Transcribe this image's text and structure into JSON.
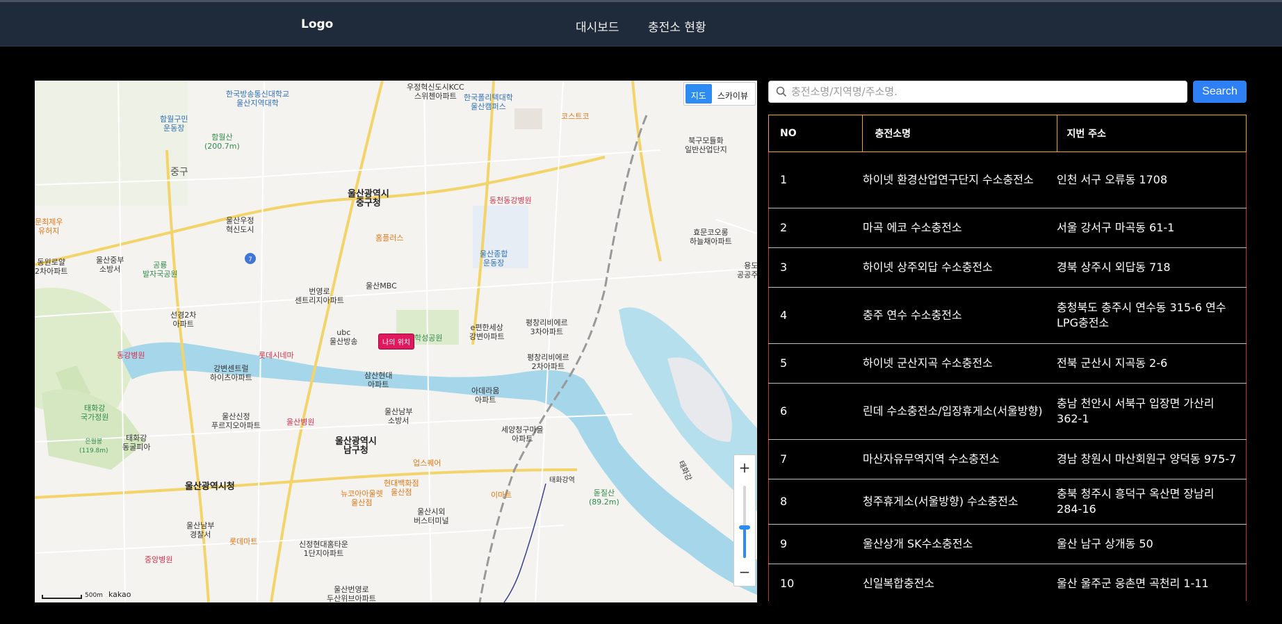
{
  "navbar": {
    "logo": "Logo",
    "links": [
      "대시보드",
      "충전소 현황"
    ]
  },
  "map": {
    "maptype": {
      "map": "지도",
      "skyview": "스카이뷰"
    },
    "my_location": "나의 위치",
    "scale": "500m",
    "provider": "kakao",
    "zoom_in": "+",
    "zoom_out": "−",
    "zoom_level_fraction": 0.42,
    "labels": [
      {
        "text": "우정혁신도시KCC\n스위첸아파트",
        "cls": ""
      },
      {
        "text": "한국방송통신대학교\n울산지역대학",
        "cls": "blue"
      },
      {
        "text": "한국폴리텍대학\n울산캠퍼스",
        "cls": "blue"
      },
      {
        "text": "코스트코",
        "cls": "orange"
      },
      {
        "text": "함월구민\n운동장",
        "cls": "blue"
      },
      {
        "text": "함월산\n(200.7m)",
        "cls": "green"
      },
      {
        "text": "중구",
        "cls": "district"
      },
      {
        "text": "북구모듈화\n일반산업단지",
        "cls": ""
      },
      {
        "text": "울산광역시\n중구청",
        "cls": "big"
      },
      {
        "text": "동천동강병원",
        "cls": "red"
      },
      {
        "text": "문최제우\n유허지",
        "cls": "orange"
      },
      {
        "text": "울산우정\n혁신도시",
        "cls": ""
      },
      {
        "text": "홈플러스",
        "cls": "orange"
      },
      {
        "text": "효문코오롱\n하늘채아파트",
        "cls": ""
      },
      {
        "text": "동원로얄\n2차아파트",
        "cls": ""
      },
      {
        "text": "울산중부\n소방서",
        "cls": ""
      },
      {
        "text": "공룡\n발자국공원",
        "cls": "green"
      },
      {
        "text": "울산종합\n운동장",
        "cls": "blue"
      },
      {
        "text": "울산MBC",
        "cls": ""
      },
      {
        "text": "번영로\n센트리지아파트",
        "cls": ""
      },
      {
        "text": "선경2차\n아파트",
        "cls": ""
      },
      {
        "text": "평창리비에르\n3차아파트",
        "cls": ""
      },
      {
        "text": "ubc\n울산방송",
        "cls": ""
      },
      {
        "text": "학성공원",
        "cls": "green"
      },
      {
        "text": "e편한세상\n강변아파트",
        "cls": ""
      },
      {
        "text": "동강병원",
        "cls": "red"
      },
      {
        "text": "롯데시네마",
        "cls": "red"
      },
      {
        "text": "평창리비에르\n2차아파트",
        "cls": ""
      },
      {
        "text": "강변센트럴\n하이츠아파트",
        "cls": ""
      },
      {
        "text": "삼산현대\n아파트",
        "cls": ""
      },
      {
        "text": "아데라움\n아파트",
        "cls": ""
      },
      {
        "text": "태화강\n국가정원",
        "cls": "green"
      },
      {
        "text": "울산신정\n푸르지오아파트",
        "cls": ""
      },
      {
        "text": "울산병원",
        "cls": "red"
      },
      {
        "text": "울산남부\n소방서",
        "cls": ""
      },
      {
        "text": "세양청구마을\n아파트",
        "cls": ""
      },
      {
        "text": "태화강\n동굴피아",
        "cls": ""
      },
      {
        "text": "은월봉\n(119.8m)",
        "cls": "green"
      },
      {
        "text": "울산광역시\n남구청",
        "cls": "big"
      },
      {
        "text": "업스퀘어",
        "cls": "orange"
      },
      {
        "text": "태화강역",
        "cls": ""
      },
      {
        "text": "돋질산\n(89.2m)",
        "cls": "green"
      },
      {
        "text": "울산광역시청",
        "cls": "big"
      },
      {
        "text": "현대백화점\n울산점",
        "cls": "orange"
      },
      {
        "text": "뉴코아아울렛\n울산점",
        "cls": "orange"
      },
      {
        "text": "이마트",
        "cls": "orange"
      },
      {
        "text": "울산시외\n버스터미널",
        "cls": ""
      },
      {
        "text": "울산남부\n경찰서",
        "cls": ""
      },
      {
        "text": "롯데마트",
        "cls": "orange"
      },
      {
        "text": "신정현대홈타운\n1단지아파트",
        "cls": ""
      },
      {
        "text": "중앙병원",
        "cls": "red"
      },
      {
        "text": "울산번영로\n두산위브아파트",
        "cls": ""
      },
      {
        "text": "태화강",
        "cls": ""
      },
      {
        "text": "용도\n공공주택",
        "cls": ""
      }
    ]
  },
  "search": {
    "placeholder": "충전소명/지역명/주소명.",
    "value": "",
    "button": "Search"
  },
  "table": {
    "headers": [
      "NO",
      "충전소명",
      "지번 주소"
    ],
    "rows": [
      {
        "no": "1",
        "name": "하이넷 환경산업연구단지 수소충전소",
        "addr": "인천 서구 오류동 1708"
      },
      {
        "no": "2",
        "name": "마곡 에코 수소충전소",
        "addr": "서울 강서구 마곡동 61-1"
      },
      {
        "no": "3",
        "name": "하이넷 상주외답 수소충전소",
        "addr": "경북 상주시 외답동 718"
      },
      {
        "no": "4",
        "name": "충주 연수 수소충전소",
        "addr": "충청북도 충주시 연수동 315-6 연수LPG충전소"
      },
      {
        "no": "5",
        "name": "하이넷 군산지곡 수소충전소",
        "addr": "전북 군산시 지곡동 2-6"
      },
      {
        "no": "6",
        "name": "린데 수소충전소/입장휴게소(서울방향)",
        "addr": "충남 천안시 서북구 입장면 가산리 362-1"
      },
      {
        "no": "7",
        "name": "마산자유무역지역 수소충전소",
        "addr": "경남 창원시 마산회원구 양덕동 975-7"
      },
      {
        "no": "8",
        "name": "청주휴게소(서울방향) 수소충전소",
        "addr": "충북 청주시 흥덕구 옥산면 장남리 284-16"
      },
      {
        "no": "9",
        "name": "울산상개 SK수소충전소",
        "addr": "울산 남구 상개동 50"
      },
      {
        "no": "10",
        "name": "신일복합충전소",
        "addr": "울산 울주군 웅촌면 곡천리 1-11"
      }
    ]
  }
}
